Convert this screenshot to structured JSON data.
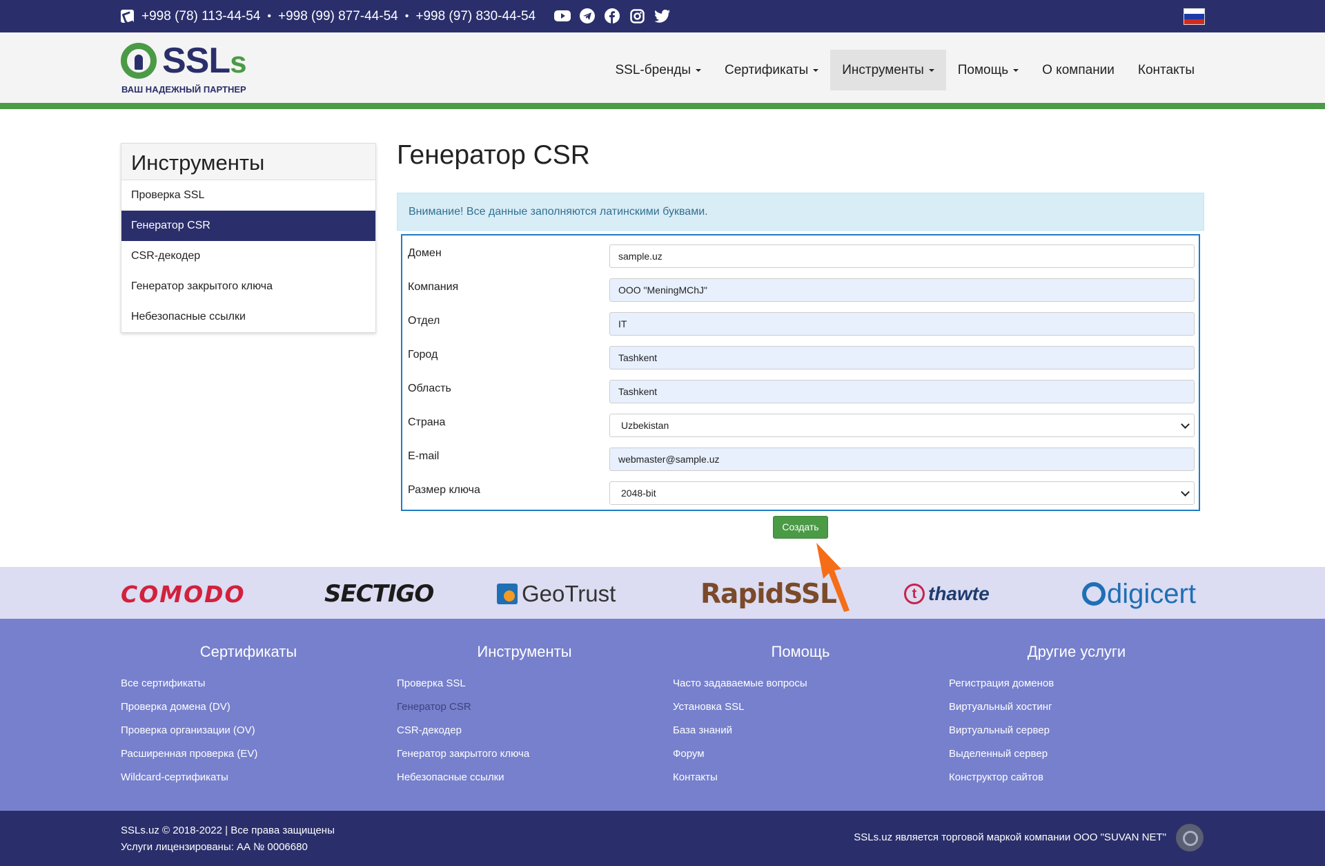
{
  "topbar": {
    "phones": [
      "+998 (78) 113-44-54",
      "+998 (99) 877-44-54",
      "+998 (97) 830-44-54"
    ],
    "separator": "•",
    "social_icons": [
      "youtube-icon",
      "telegram-icon",
      "facebook-icon",
      "instagram-icon",
      "twitter-icon"
    ],
    "language_flag": "russian-flag"
  },
  "header": {
    "logo_text": "SSLs",
    "logo_tagline": "ВАШ НАДЕЖНЫЙ ПАРТНЕР",
    "nav": [
      {
        "label": "SSL-бренды",
        "dropdown": true
      },
      {
        "label": "Сертификаты",
        "dropdown": true
      },
      {
        "label": "Инструменты",
        "dropdown": true,
        "active": true
      },
      {
        "label": "Помощь",
        "dropdown": true
      },
      {
        "label": "О компании",
        "dropdown": false
      },
      {
        "label": "Контакты",
        "dropdown": false
      }
    ]
  },
  "sidebar": {
    "title": "Инструменты",
    "links": [
      {
        "label": "Проверка SSL"
      },
      {
        "label": "Генератор CSR",
        "active": true
      },
      {
        "label": "CSR-декодер"
      },
      {
        "label": "Генератор закрытого ключа"
      },
      {
        "label": "Небезопасные ссылки"
      }
    ]
  },
  "main": {
    "title": "Генератор CSR",
    "alert": "Внимание! Все данные заполняются латинскими буквами.",
    "form": [
      {
        "label": "Домен",
        "value": "sample.uz",
        "type": "text",
        "autofilled": false
      },
      {
        "label": "Компания",
        "value": "OOO \"MeningMChJ\"",
        "type": "text",
        "autofilled": true
      },
      {
        "label": "Отдел",
        "value": "IT",
        "type": "text",
        "autofilled": true
      },
      {
        "label": "Город",
        "value": "Tashkent",
        "type": "text",
        "autofilled": true
      },
      {
        "label": "Область",
        "value": "Tashkent",
        "type": "text",
        "autofilled": true
      },
      {
        "label": "Страна",
        "value": "Uzbekistan",
        "type": "select",
        "autofilled": false
      },
      {
        "label": "E-mail",
        "value": "webmaster@sample.uz",
        "type": "text",
        "autofilled": true
      },
      {
        "label": "Размер ключа",
        "value": "2048-bit",
        "type": "select",
        "autofilled": false
      }
    ],
    "submit_label": "Создать"
  },
  "brands": [
    "COMODO",
    "SECTIGO",
    "GeoTrust",
    "RapidSSL",
    "thawte",
    "digicert"
  ],
  "footer": {
    "columns": [
      {
        "title": "Сертификаты",
        "links": [
          "Все сертификаты",
          "Проверка домена (DV)",
          "Проверка организации (OV)",
          "Расширенная проверка (EV)",
          "Wildcard-сертификаты"
        ]
      },
      {
        "title": "Инструменты",
        "links": [
          "Проверка SSL",
          "Генератор CSR",
          "CSR-декодер",
          "Генератор закрытого ключа",
          "Небезопасные ссылки"
        ]
      },
      {
        "title": "Помощь",
        "links": [
          "Часто задаваемые вопросы",
          "Установка SSL",
          "База знаний",
          "Форум",
          "Контакты"
        ]
      },
      {
        "title": "Другие услуги",
        "links": [
          "Регистрация доменов",
          "Виртуальный хостинг",
          "Виртуальный сервер",
          "Выделенный сервер",
          "Конструктор сайтов"
        ]
      }
    ],
    "copyright": "SSLs.uz © 2018-2022 | Все права защищены",
    "license": "Услуги лицензированы: АА № 0006680",
    "trademark": "SSLs.uz является торговой маркой компании ООО \"SUVAN NET\""
  },
  "colors": {
    "navy": "#2a2f6b",
    "green": "#4b9a46",
    "footer_bg": "#7780cc",
    "alert_bg": "#d9edf7",
    "arrow": "#f56d16"
  }
}
